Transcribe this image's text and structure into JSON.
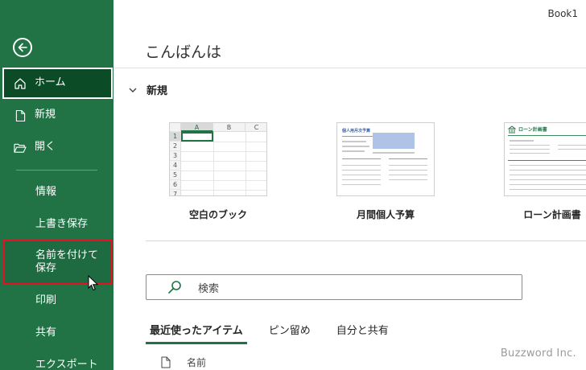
{
  "window": {
    "doc_title": "Book1"
  },
  "sidebar": {
    "back_icon": "back-arrow-icon",
    "items": [
      {
        "label": "ホーム",
        "icon": "home-icon"
      },
      {
        "label": "新規",
        "icon": "new-document-icon"
      },
      {
        "label": "開く",
        "icon": "open-folder-icon"
      },
      {
        "label": "情報"
      },
      {
        "label": "上書き保存"
      },
      {
        "label": "名前を付けて保存"
      },
      {
        "label": "印刷"
      },
      {
        "label": "共有"
      },
      {
        "label": "エクスポート"
      }
    ],
    "colors": {
      "background": "#217346",
      "selected": "#0b4c26",
      "highlight_border": "#e81123"
    }
  },
  "main": {
    "greeting": "こんばんは",
    "new_section": {
      "title": "新規",
      "templates": [
        {
          "label": "空白のブック",
          "columns": [
            "A",
            "B",
            "C"
          ],
          "rows": [
            "1",
            "2",
            "3",
            "4",
            "5",
            "6",
            "7"
          ]
        },
        {
          "label": "月間個人予算",
          "thumb_title": "個人用月次予算"
        },
        {
          "label": "ローン計画書",
          "thumb_title": "ローン計画書"
        }
      ]
    },
    "search": {
      "placeholder": "検索",
      "icon": "search-icon"
    },
    "tabs": [
      {
        "label": "最近使ったアイテム",
        "active": true
      },
      {
        "label": "ピン留め",
        "active": false
      },
      {
        "label": "自分と共有",
        "active": false
      }
    ],
    "file_list": {
      "name_header": "名前",
      "icon": "file-icon"
    }
  },
  "watermark": "Buzzword Inc."
}
